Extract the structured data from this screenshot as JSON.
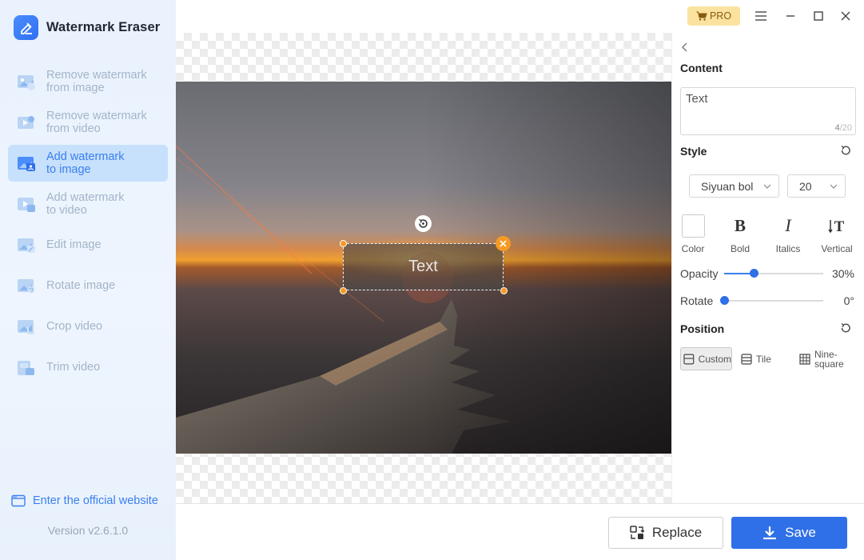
{
  "app": {
    "title": "Watermark Eraser"
  },
  "sidebar": {
    "items": [
      {
        "label": "Remove watermark\nfrom image",
        "icon": "image-eraser-icon",
        "active": false
      },
      {
        "label": "Remove watermark\nfrom video",
        "icon": "video-eraser-icon",
        "active": false
      },
      {
        "label": "Add watermark\nto image",
        "icon": "image-watermark-icon",
        "active": true
      },
      {
        "label": "Add watermark\nto video",
        "icon": "video-watermark-icon",
        "active": false
      },
      {
        "label": "Edit image",
        "icon": "edit-image-icon",
        "active": false
      },
      {
        "label": "Rotate image",
        "icon": "rotate-image-icon",
        "active": false
      },
      {
        "label": "Crop video",
        "icon": "crop-video-icon",
        "active": false
      },
      {
        "label": "Trim video",
        "icon": "trim-video-icon",
        "active": false
      }
    ],
    "website_link": "Enter the official website",
    "version": "Version v2.6.1.0"
  },
  "titlebar": {
    "pro_label": "PRO",
    "icons": [
      "cart-icon",
      "menu-icon",
      "minimize-icon",
      "maximize-icon",
      "close-icon"
    ]
  },
  "canvas": {
    "watermark_text": "Text"
  },
  "panel": {
    "content_title": "Content",
    "content_value": "Text",
    "counter_current": "4",
    "counter_max": "/20",
    "style_title": "Style",
    "font_family": "Siyuan bol",
    "font_size": "20",
    "tools": {
      "color": "Color",
      "bold": "Bold",
      "italics": "Italics",
      "vertical": "Vertical"
    },
    "opacity_label": "Opacity",
    "opacity_value": "30%",
    "opacity_fraction": 0.3,
    "rotate_label": "Rotate",
    "rotate_value": "0°",
    "rotate_fraction": 0.0,
    "position_title": "Position",
    "position_options": [
      {
        "label": "Custom",
        "active": true
      },
      {
        "label": "Tile",
        "active": false
      },
      {
        "label": "Nine-\nsquare",
        "active": false
      }
    ]
  },
  "bottom": {
    "replace_label": "Replace",
    "save_label": "Save"
  },
  "colors": {
    "accent": "#2f6fe8",
    "pro": "#fbe39f",
    "handle": "#f59b23"
  }
}
